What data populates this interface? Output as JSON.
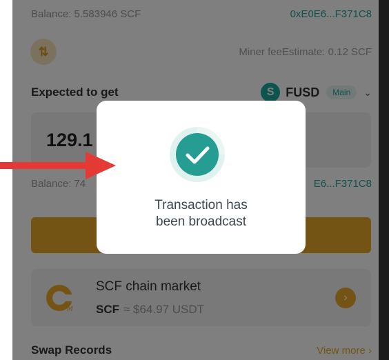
{
  "balance_top": {
    "label": "Balance: 5.583946 SCF",
    "address": "0xE0E6...F371C8"
  },
  "miner_fee": "Miner feeEstimate: 0.12 SCF",
  "swap_icon_glyph": "⇅",
  "expected": {
    "label": "Expected to get",
    "token_symbol": "FUSD",
    "token_logo_letter": "S",
    "badge": "Main",
    "chevron": "⌄"
  },
  "amount": {
    "value": "129.1"
  },
  "balance_bottom": {
    "label": "Balance: 74",
    "address": "E6...F371C8"
  },
  "market": {
    "title": "SCF chain market",
    "symbol": "SCF",
    "price": "≈ $64.97 USDT",
    "go": "›"
  },
  "records": {
    "title": "Swap Records",
    "view_more": "View more ›"
  },
  "modal": {
    "line1": "Transaction has",
    "line2": "been broadcast"
  },
  "colors": {
    "accent": "#e7a928",
    "teal": "#25a39a",
    "arrow": "#e53935"
  },
  "icons": {
    "swap": "swap-vertical-icon",
    "token": "fusd-token-icon",
    "market": "scf-logo-icon",
    "success": "check-circle-icon",
    "pointer": "red-arrow-icon"
  }
}
